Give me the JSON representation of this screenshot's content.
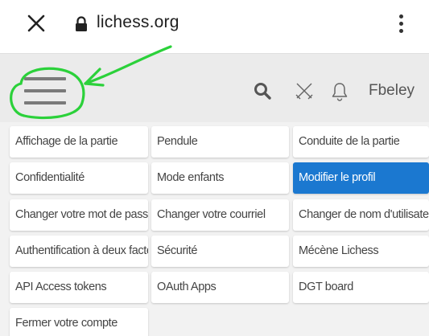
{
  "browser": {
    "url": "lichess.org",
    "close_icon": "close-icon",
    "lock_icon": "lock-icon",
    "menu_icon": "kebab-menu-icon"
  },
  "header": {
    "username": "Fbeley",
    "icons": [
      "hamburger-menu-icon",
      "search-icon",
      "swords-icon",
      "bell-icon"
    ],
    "annotation_color": "#2bd13a"
  },
  "menu": {
    "active_color": "#1b78d0",
    "items": [
      {
        "label": "Affichage de la partie"
      },
      {
        "label": "Pendule"
      },
      {
        "label": "Conduite de la partie"
      },
      {
        "label": "Confidentialité"
      },
      {
        "label": "Mode enfants"
      },
      {
        "label": "Modifier le profil"
      },
      {
        "label": "Changer votre mot de passe"
      },
      {
        "label": "Changer votre courriel"
      },
      {
        "label": "Changer de nom d'utilisateur"
      },
      {
        "label": "Authentification à deux facteurs"
      },
      {
        "label": "Sécurité"
      },
      {
        "label": "Mécène Lichess"
      },
      {
        "label": "API Access tokens"
      },
      {
        "label": "OAuth Apps"
      },
      {
        "label": "DGT board"
      },
      {
        "label": "Fermer votre compte"
      }
    ]
  }
}
